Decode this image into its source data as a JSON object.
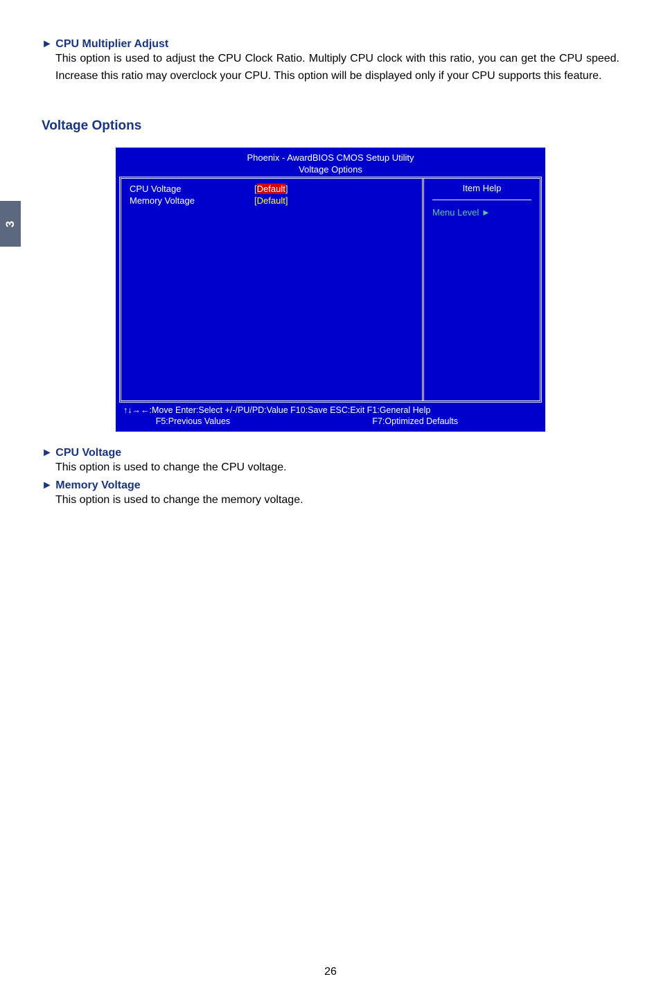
{
  "sideTab": {
    "label": "3"
  },
  "items": [
    {
      "marker": "►",
      "title": "CPU Multiplier Adjust",
      "desc": "This option is used to adjust the CPU Clock Ratio. Multiply CPU clock with this ratio, you can get the CPU speed. Increase this ratio may overclock your CPU. This option will be displayed only if your CPU supports this feature."
    }
  ],
  "section": {
    "title": "Voltage Options"
  },
  "bios": {
    "title1": "Phoenix - AwardBIOS CMOS Setup Utility",
    "title2": "Voltage Options",
    "rows": [
      {
        "name": "CPU Voltage",
        "lb": "[",
        "val": "Default",
        "rb": "]",
        "selected": true
      },
      {
        "name": "Memory Voltage",
        "lb": "[",
        "val": "Default",
        "rb": "]",
        "selected": false
      }
    ],
    "help": {
      "heading": "Item Help",
      "menuLevel": "Menu Level  ►"
    },
    "footer": {
      "line1": "↑↓→←:Move   Enter:Select    +/-/PU/PD:Value   F10:Save     ESC:Exit   F1:General Help",
      "line2a": "F5:Previous Values",
      "line2b": "F7:Optimized Defaults"
    }
  },
  "postItems": [
    {
      "marker": "►",
      "title": "CPU  Voltage",
      "desc": "This option is used to change the CPU voltage."
    },
    {
      "marker": "►",
      "title": "Memory  Voltage",
      "desc": "This option is used to change the memory voltage."
    }
  ],
  "pageNumber": "26"
}
